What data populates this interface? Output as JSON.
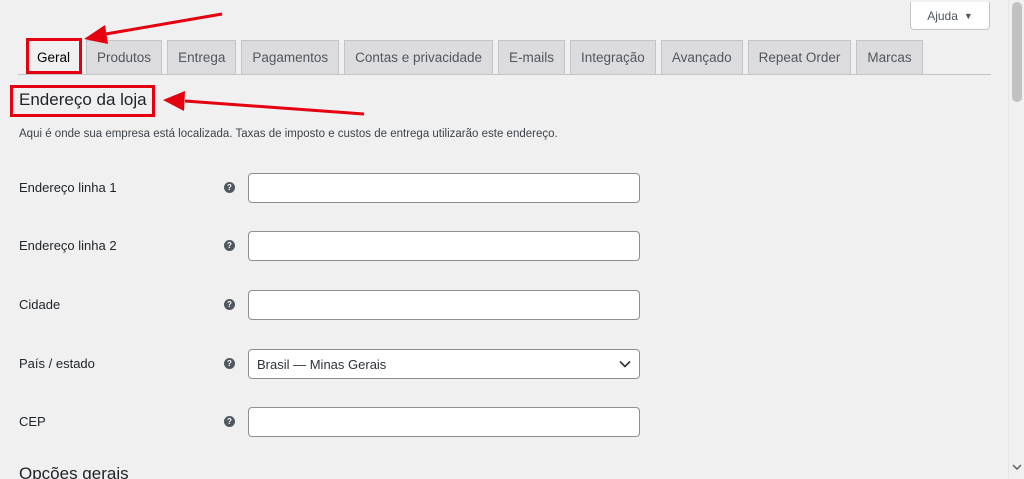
{
  "help": {
    "label": "Ajuda",
    "caret": "▼"
  },
  "tabs": [
    {
      "label": "Geral"
    },
    {
      "label": "Produtos"
    },
    {
      "label": "Entrega"
    },
    {
      "label": "Pagamentos"
    },
    {
      "label": "Contas e privacidade"
    },
    {
      "label": "E-mails"
    },
    {
      "label": "Integração"
    },
    {
      "label": "Avançado"
    },
    {
      "label": "Repeat Order"
    },
    {
      "label": "Marcas"
    }
  ],
  "section": {
    "title": "Endereço da loja",
    "description": "Aqui é onde sua empresa está localizada. Taxas de imposto e custos de entrega utilizarão este endereço."
  },
  "fields": {
    "address1": {
      "label": "Endereço linha 1",
      "value": ""
    },
    "address2": {
      "label": "Endereço linha 2",
      "value": ""
    },
    "city": {
      "label": "Cidade",
      "value": ""
    },
    "country": {
      "label": "País / estado",
      "value": "Brasil — Minas Gerais"
    },
    "postcode": {
      "label": "CEP",
      "value": ""
    }
  },
  "help_tip_glyph": "?",
  "next_section": {
    "title": "Opções gerais"
  },
  "annotations": {
    "color": "#e5000f"
  }
}
